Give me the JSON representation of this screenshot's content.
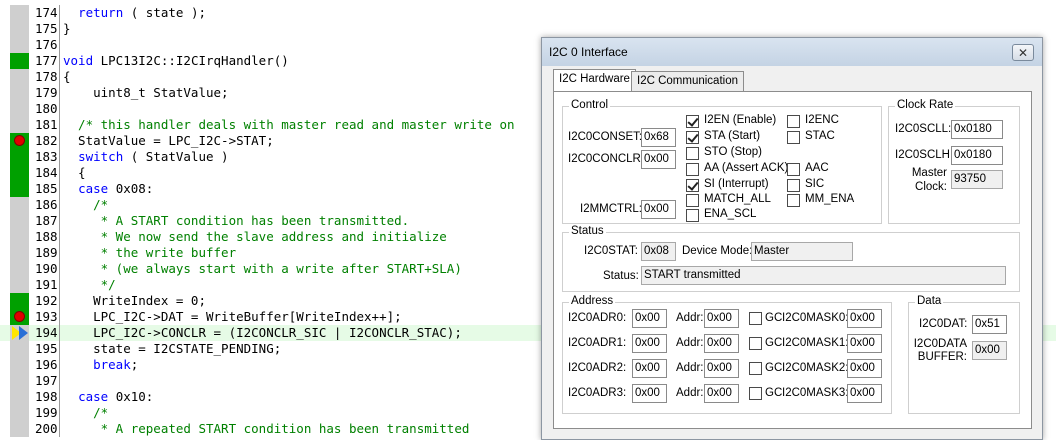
{
  "editor": {
    "lines": [
      {
        "num": "174",
        "segments": [
          {
            "t": "  ",
            "c": "nm"
          },
          {
            "t": "return",
            "c": "kw"
          },
          {
            "t": " ( state );",
            "c": "nm"
          }
        ],
        "gutter": "grey",
        "marker": "none",
        "highlight": false
      },
      {
        "num": "175",
        "segments": [
          {
            "t": "}",
            "c": "nm"
          }
        ],
        "gutter": "grey",
        "marker": "none",
        "highlight": false
      },
      {
        "num": "176",
        "segments": [],
        "gutter": "grey",
        "marker": "none",
        "highlight": false
      },
      {
        "num": "177",
        "segments": [
          {
            "t": "void",
            "c": "kw"
          },
          {
            "t": " LPC13I2C::I2CIrqHandler()",
            "c": "nm"
          }
        ],
        "gutter": "green",
        "marker": "none",
        "highlight": false
      },
      {
        "num": "178",
        "segments": [
          {
            "t": "{",
            "c": "nm"
          }
        ],
        "gutter": "grey",
        "marker": "none",
        "highlight": false
      },
      {
        "num": "179",
        "segments": [
          {
            "t": "    uint8_t StatValue;",
            "c": "nm"
          }
        ],
        "gutter": "grey",
        "marker": "none",
        "highlight": false
      },
      {
        "num": "180",
        "segments": [],
        "gutter": "grey",
        "marker": "none",
        "highlight": false
      },
      {
        "num": "181",
        "segments": [
          {
            "t": "  /* this handler deals with master read and master write on",
            "c": "cm"
          }
        ],
        "gutter": "grey",
        "marker": "none",
        "highlight": false
      },
      {
        "num": "182",
        "segments": [
          {
            "t": "  StatValue = LPC_I2C->STAT;",
            "c": "nm"
          }
        ],
        "gutter": "green",
        "marker": "bp",
        "highlight": false
      },
      {
        "num": "183",
        "segments": [
          {
            "t": "  ",
            "c": "nm"
          },
          {
            "t": "switch",
            "c": "kw"
          },
          {
            "t": " ( StatValue )",
            "c": "nm"
          }
        ],
        "gutter": "green",
        "marker": "none",
        "highlight": false
      },
      {
        "num": "184",
        "segments": [
          {
            "t": "  {",
            "c": "nm"
          }
        ],
        "gutter": "green",
        "marker": "none",
        "highlight": false
      },
      {
        "num": "185",
        "segments": [
          {
            "t": "  ",
            "c": "nm"
          },
          {
            "t": "case",
            "c": "kw"
          },
          {
            "t": " 0x08:",
            "c": "nm"
          }
        ],
        "gutter": "green",
        "marker": "none",
        "highlight": false
      },
      {
        "num": "186",
        "segments": [
          {
            "t": "    /*",
            "c": "cm"
          }
        ],
        "gutter": "grey",
        "marker": "none",
        "highlight": false
      },
      {
        "num": "187",
        "segments": [
          {
            "t": "     * A START condition has been transmitted.",
            "c": "cm"
          }
        ],
        "gutter": "grey",
        "marker": "none",
        "highlight": false
      },
      {
        "num": "188",
        "segments": [
          {
            "t": "     * We now send the slave address and initialize",
            "c": "cm"
          }
        ],
        "gutter": "grey",
        "marker": "none",
        "highlight": false
      },
      {
        "num": "189",
        "segments": [
          {
            "t": "     * the write buffer",
            "c": "cm"
          }
        ],
        "gutter": "grey",
        "marker": "none",
        "highlight": false
      },
      {
        "num": "190",
        "segments": [
          {
            "t": "     * (we always start with a write after START+SLA)",
            "c": "cm"
          }
        ],
        "gutter": "grey",
        "marker": "none",
        "highlight": false
      },
      {
        "num": "191",
        "segments": [
          {
            "t": "     */",
            "c": "cm"
          }
        ],
        "gutter": "grey",
        "marker": "none",
        "highlight": false
      },
      {
        "num": "192",
        "segments": [
          {
            "t": "    WriteIndex = 0;",
            "c": "nm"
          }
        ],
        "gutter": "green",
        "marker": "none",
        "highlight": false
      },
      {
        "num": "193",
        "segments": [
          {
            "t": "    LPC_I2C->DAT = WriteBuffer[WriteIndex++];",
            "c": "nm"
          }
        ],
        "gutter": "green",
        "marker": "bp",
        "highlight": false
      },
      {
        "num": "194",
        "segments": [
          {
            "t": "    LPC_I2C->CONCLR = (I2CONCLR_SIC | I2CONCLR_STAC);",
            "c": "nm"
          }
        ],
        "gutter": "grey",
        "marker": "arrow",
        "highlight": true
      },
      {
        "num": "195",
        "segments": [
          {
            "t": "    state = I2CSTATE_PENDING;",
            "c": "nm"
          }
        ],
        "gutter": "grey",
        "marker": "none",
        "highlight": false
      },
      {
        "num": "196",
        "segments": [
          {
            "t": "    ",
            "c": "nm"
          },
          {
            "t": "break",
            "c": "kw"
          },
          {
            "t": ";",
            "c": "nm"
          }
        ],
        "gutter": "grey",
        "marker": "none",
        "highlight": false
      },
      {
        "num": "197",
        "segments": [],
        "gutter": "grey",
        "marker": "none",
        "highlight": false
      },
      {
        "num": "198",
        "segments": [
          {
            "t": "  ",
            "c": "nm"
          },
          {
            "t": "case",
            "c": "kw"
          },
          {
            "t": " 0x10:",
            "c": "nm"
          }
        ],
        "gutter": "grey",
        "marker": "none",
        "highlight": false
      },
      {
        "num": "199",
        "segments": [
          {
            "t": "    /*",
            "c": "cm"
          }
        ],
        "gutter": "grey",
        "marker": "none",
        "highlight": false
      },
      {
        "num": "200",
        "segments": [
          {
            "t": "     * A repeated START condition has been transmitted",
            "c": "cm"
          }
        ],
        "gutter": "grey",
        "marker": "none",
        "highlight": false
      }
    ]
  },
  "dialog": {
    "title": "I2C 0 Interface",
    "close_icon": "close-icon",
    "tabs": [
      {
        "label": "I2C Hardware",
        "active": true
      },
      {
        "label": "I2C Communication",
        "active": false
      }
    ],
    "control": {
      "title": "Control",
      "conset_label": "I2C0CONSET:",
      "conset_value": "0x68",
      "conclr_label": "I2C0CONCLR:",
      "conclr_value": "0x00",
      "mmctrl_label": "I2MMCTRL:",
      "mmctrl_value": "0x00",
      "checks": [
        {
          "label": "I2EN (Enable)",
          "checked": true
        },
        {
          "label": "I2ENC",
          "checked": false
        },
        {
          "label": "STA (Start)",
          "checked": true
        },
        {
          "label": "STAC",
          "checked": false
        },
        {
          "label": "STO (Stop)",
          "checked": false
        },
        {
          "label": "AA (Assert ACK)",
          "checked": false
        },
        {
          "label": "AAC",
          "checked": false
        },
        {
          "label": "SI (Interrupt)",
          "checked": true
        },
        {
          "label": "SIC",
          "checked": false
        },
        {
          "label": "MATCH_ALL",
          "checked": false
        },
        {
          "label": "MM_ENA",
          "checked": false
        },
        {
          "label": "ENA_SCL",
          "checked": false
        }
      ]
    },
    "clock": {
      "title": "Clock Rate",
      "scll_label": "I2C0SCLL:",
      "scll_value": "0x0180",
      "sclh_label": "I2C0SCLH:",
      "sclh_value": "0x0180",
      "master_label_1": "Master",
      "master_label_2": "Clock:",
      "master_value": "93750"
    },
    "status": {
      "title": "Status",
      "stat_label": "I2C0STAT:",
      "stat_value": "0x08",
      "mode_label": "Device Mode:",
      "mode_value": "Master",
      "status_label": "Status:",
      "status_value": "START transmitted"
    },
    "address": {
      "title": "Address",
      "addr_label": "Addr:",
      "gc_label": "GC",
      "rows": [
        {
          "adr_label": "I2C0ADR0:",
          "adr_value": "0x00",
          "addr_value": "0x00",
          "mask_label": "I2C0MASK0:",
          "mask_value": "0x00"
        },
        {
          "adr_label": "I2C0ADR1:",
          "adr_value": "0x00",
          "addr_value": "0x00",
          "mask_label": "I2C0MASK1:",
          "mask_value": "0x00"
        },
        {
          "adr_label": "I2C0ADR2:",
          "adr_value": "0x00",
          "addr_value": "0x00",
          "mask_label": "I2C0MASK2:",
          "mask_value": "0x00"
        },
        {
          "adr_label": "I2C0ADR3:",
          "adr_value": "0x00",
          "addr_value": "0x00",
          "mask_label": "I2C0MASK3:",
          "mask_value": "0x00"
        }
      ]
    },
    "data": {
      "title": "Data",
      "dat_label": "I2C0DAT:",
      "dat_value": "0x51",
      "buffer_label_1": "I2C0DATA",
      "buffer_label_2": "BUFFER:",
      "buffer_value": "0x00"
    }
  }
}
